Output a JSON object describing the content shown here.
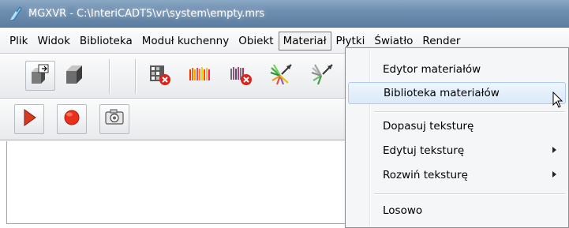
{
  "window": {
    "title": "MGXVR - C:\\InteriCADT5\\vr\\system\\empty.mrs"
  },
  "menubar": {
    "items": [
      "Plik",
      "Widok",
      "Biblioteka",
      "Moduł kuchenny",
      "Obiekt",
      "Materiał",
      "Płytki",
      "Światło",
      "Render"
    ],
    "active": "Materiał"
  },
  "toolbar1": {
    "icons": [
      "copy-object-icon",
      "solid-box-icon",
      "material-delete-icon",
      "color-bars-icon",
      "color-bars-delete-icon",
      "texture-rays-icon",
      "texture-rays-2-icon"
    ]
  },
  "toolbar2": {
    "icons": [
      "play-icon",
      "record-icon",
      "camera-icon"
    ]
  },
  "dropdown": {
    "items": [
      {
        "label": "Edytor materiałów",
        "submenu": false
      },
      {
        "label": "Biblioteka materiałów",
        "submenu": false,
        "highlighted": true
      },
      {
        "label": "Dopasuj teksturę",
        "submenu": false
      },
      {
        "label": "Edytuj teksturę",
        "submenu": true
      },
      {
        "label": "Rozwiń teksturę",
        "submenu": true
      },
      {
        "label": "Losowo",
        "submenu": false
      }
    ]
  },
  "colors": {
    "titlebar": "#6f8fb0",
    "highlight": "#dbe9f9",
    "record_red": "#e8301c"
  }
}
